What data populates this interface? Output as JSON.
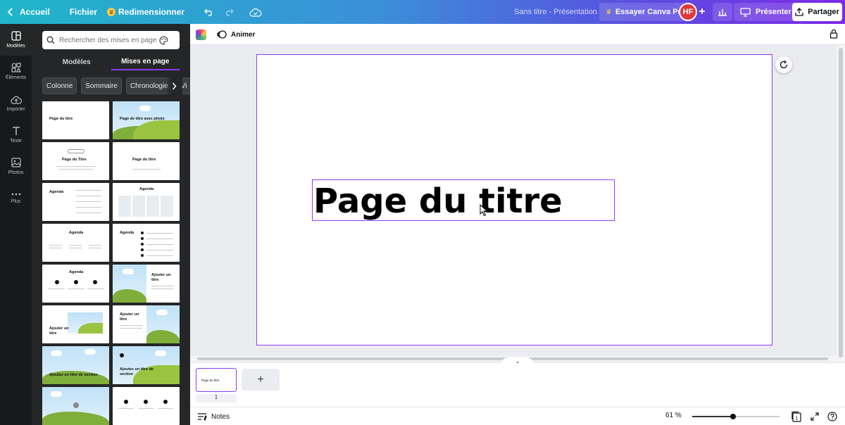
{
  "topbar": {
    "home": "Accueil",
    "file": "Fichier",
    "resize": "Redimensionner",
    "doc_title": "Sans titre - Présentation",
    "try_pro": "Essayer Canva Pro",
    "avatar_initials": "HF",
    "present": "Présenter",
    "share": "Partager"
  },
  "rail": [
    {
      "label": "Modèles",
      "icon": "templates-icon"
    },
    {
      "label": "Éléments",
      "icon": "elements-icon"
    },
    {
      "label": "Importer",
      "icon": "upload-icon"
    },
    {
      "label": "Texte",
      "icon": "text-icon"
    },
    {
      "label": "Photos",
      "icon": "photos-icon"
    },
    {
      "label": "Plus",
      "icon": "more-icon"
    }
  ],
  "panel": {
    "search_placeholder": "Rechercher des mises en page de",
    "tabs": [
      "Modèles",
      "Mises en page"
    ],
    "chips": [
      "Colonne",
      "Sommaire",
      "Chronologie",
      "Vi"
    ],
    "templates": [
      "Page du titre",
      "Page de titre avec photo",
      "Page du Titre",
      "Page du titre",
      "Agenda",
      "Agenda",
      "Agenda",
      "Agenda",
      "Agenda",
      "Ajouter un titre",
      "Ajouter un titre",
      "Ajouter un titre",
      "Ajoutez un titre de section",
      "Ajoutez un titre de section"
    ]
  },
  "editor": {
    "animate": "Animer",
    "slide_title": "Page du titre"
  },
  "pages": {
    "thumb_text": "Page du titre",
    "page_number": "1",
    "add_label": "+"
  },
  "footer": {
    "notes": "Notes",
    "zoom": "61 %",
    "zoom_fraction": 0.47,
    "page_count": "1"
  },
  "colors": {
    "accent": "#8b3dff",
    "rail_bg": "#18191b",
    "panel_bg": "#252627"
  }
}
